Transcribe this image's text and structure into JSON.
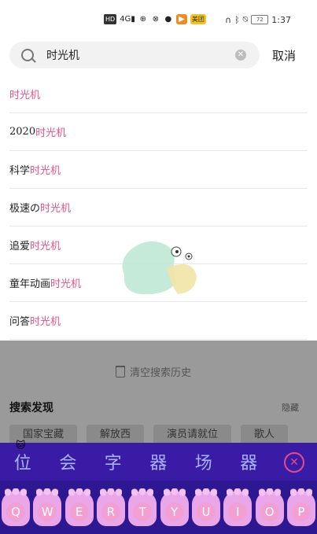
{
  "status_bar": {
    "left_icons": [
      "HD",
      "4G signal",
      "link",
      "vpn",
      "wechat",
      "video",
      "美团"
    ],
    "hd_label": "HD",
    "network_label": "4G",
    "meituan_label": "美团",
    "battery_label": "72",
    "time": "1:37"
  },
  "search": {
    "query": "时光机",
    "clear_symbol": "✕",
    "cancel_label": "取消"
  },
  "suggestions": [
    {
      "prefix": "",
      "highlight": "时光机"
    },
    {
      "prefix": "2020",
      "highlight": "时光机"
    },
    {
      "prefix": "科学",
      "highlight": "时光机"
    },
    {
      "prefix": "极速の",
      "highlight": "时光机"
    },
    {
      "prefix": "追爱",
      "highlight": "时光机"
    },
    {
      "prefix": "童年动画",
      "highlight": "时光机"
    },
    {
      "prefix": "问答",
      "highlight": "时光机"
    }
  ],
  "history": {
    "clear_label": "清空搜索历史"
  },
  "discover": {
    "title": "搜索发现",
    "hide_label": "隐藏",
    "tags": [
      "国家宝藏",
      "解放西",
      "演员请就位",
      "歌人"
    ]
  },
  "keyboard": {
    "candidates": [
      "位",
      "会",
      "字",
      "器",
      "场",
      "器"
    ],
    "close_symbol": "✕",
    "keys": [
      "Q",
      "W",
      "E",
      "R",
      "T",
      "Y",
      "U",
      "I",
      "O",
      "P"
    ]
  },
  "colors": {
    "highlight": "#e8538a",
    "keyboard_bg": "#3a1ba6",
    "candidate_text": "#a8b3ff",
    "key_pink": "#e9a7e9"
  }
}
